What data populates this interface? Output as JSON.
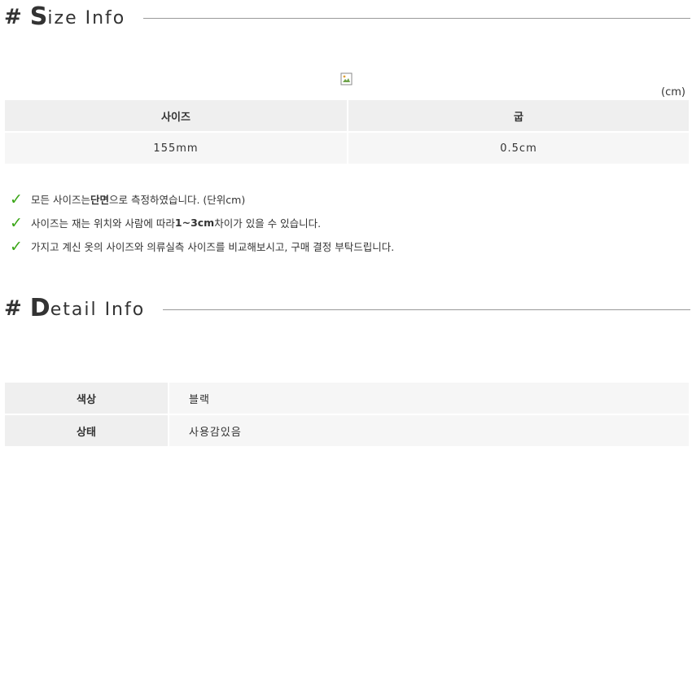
{
  "size_section": {
    "hash": "#",
    "title_first": "S",
    "title_rest": "ize Info",
    "unit": "(cm)",
    "table": {
      "headers": [
        "사이즈",
        "굽"
      ],
      "rows": [
        [
          "155mm",
          "0.5cm"
        ]
      ]
    },
    "notes": [
      {
        "before": "모든 사이즈는 ",
        "bold": "단면",
        "after": " 으로 측정하였습니다. (단위cm)"
      },
      {
        "before": "사이즈는 재는 위치와 사람에 따라 ",
        "bold": "1~3cm",
        "after": "차이가 있을 수 있습니다."
      },
      {
        "before": "가지고 계신 옷의 사이즈와 의류실측 사이즈를 비교해보시고, 구매 결정 부탁드립니다.",
        "bold": "",
        "after": ""
      }
    ]
  },
  "detail_section": {
    "hash": "#",
    "title_first": "D",
    "title_rest": "etail Info",
    "rows": [
      {
        "label": "색상",
        "value": "블랙"
      },
      {
        "label": "상태",
        "value": "사용감있음"
      }
    ]
  },
  "icons": {
    "check": "check-mark-icon",
    "broken_image": "broken-image-icon"
  },
  "colors": {
    "check": "#3aa617",
    "header_bg": "#efefef",
    "cell_bg": "#f6f6f6"
  }
}
